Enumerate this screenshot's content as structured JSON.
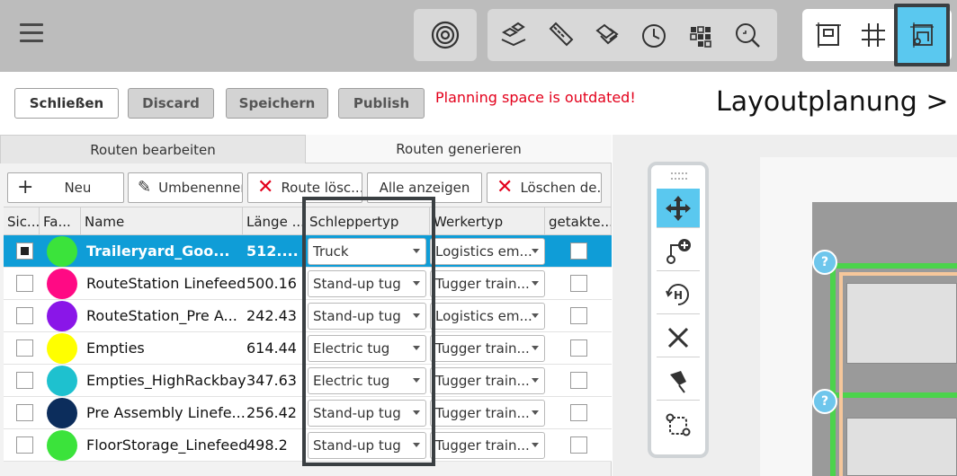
{
  "toolbar": {
    "menu_icon": "hamburger-icon",
    "group1": [
      "target-icon"
    ],
    "group2": [
      "stations-icon",
      "ruler-icon",
      "layers-icon",
      "clock-icon",
      "grid-dots-icon",
      "zoom-icon"
    ],
    "group3": [
      "frame-icon",
      "grid-icon",
      "route-icon"
    ],
    "accent_color": "#5ac8ef"
  },
  "actions": {
    "close": "Schließen",
    "discard": "Discard",
    "save": "Speichern",
    "publish": "Publish",
    "warning": "Planning space is outdated!",
    "breadcrumb": "Layoutplanung > P"
  },
  "tabs": {
    "edit": "Routen bearbeiten",
    "generate": "Routen generieren"
  },
  "route_buttons": {
    "new": "Neu",
    "rename": "Umbenennen",
    "delete_route": "Route lösc...",
    "show_all": "Alle anzeigen",
    "delete_other": "Löschen de..."
  },
  "table": {
    "columns": [
      "Sic...",
      "Fa...",
      "Name",
      "Länge ...",
      "Schleppertyp",
      "Werkertyp",
      "getakte..."
    ],
    "rows": [
      {
        "selected": true,
        "checked": true,
        "color": "#3be33b",
        "name": "Traileryard_Goo...",
        "length": "512....",
        "tug": "Truck",
        "worker": "Logistics em..."
      },
      {
        "selected": false,
        "checked": false,
        "color": "#ff0a84",
        "name": "RouteStation Linefeed",
        "length": "500.16",
        "tug": "Stand-up tug",
        "worker": "Tugger train..."
      },
      {
        "selected": false,
        "checked": false,
        "color": "#8a16e8",
        "name": "RouteStation_Pre A...",
        "length": "242.43",
        "tug": "Stand-up tug",
        "worker": "Logistics em..."
      },
      {
        "selected": false,
        "checked": false,
        "color": "#ffff00",
        "name": "Empties",
        "length": "614.44",
        "tug": "Electric tug",
        "worker": "Tugger train..."
      },
      {
        "selected": false,
        "checked": false,
        "color": "#1ec1cf",
        "name": "Empties_HighRackbay",
        "length": "347.63",
        "tug": "Electric tug",
        "worker": "Tugger train..."
      },
      {
        "selected": false,
        "checked": false,
        "color": "#0c2d5c",
        "name": "Pre Assembly Linefe...",
        "length": "256.42",
        "tug": "Stand-up tug",
        "worker": "Tugger train..."
      },
      {
        "selected": false,
        "checked": false,
        "color": "#3be33b",
        "name": "FloorStorage_Linefeed",
        "length": "498.2",
        "tug": "Stand-up tug",
        "worker": "Tugger train..."
      }
    ]
  },
  "side_tools": [
    "move-icon",
    "add-route-icon",
    "rotate-h-icon",
    "cut-icon",
    "pin-icon",
    "route-shape-icon"
  ]
}
